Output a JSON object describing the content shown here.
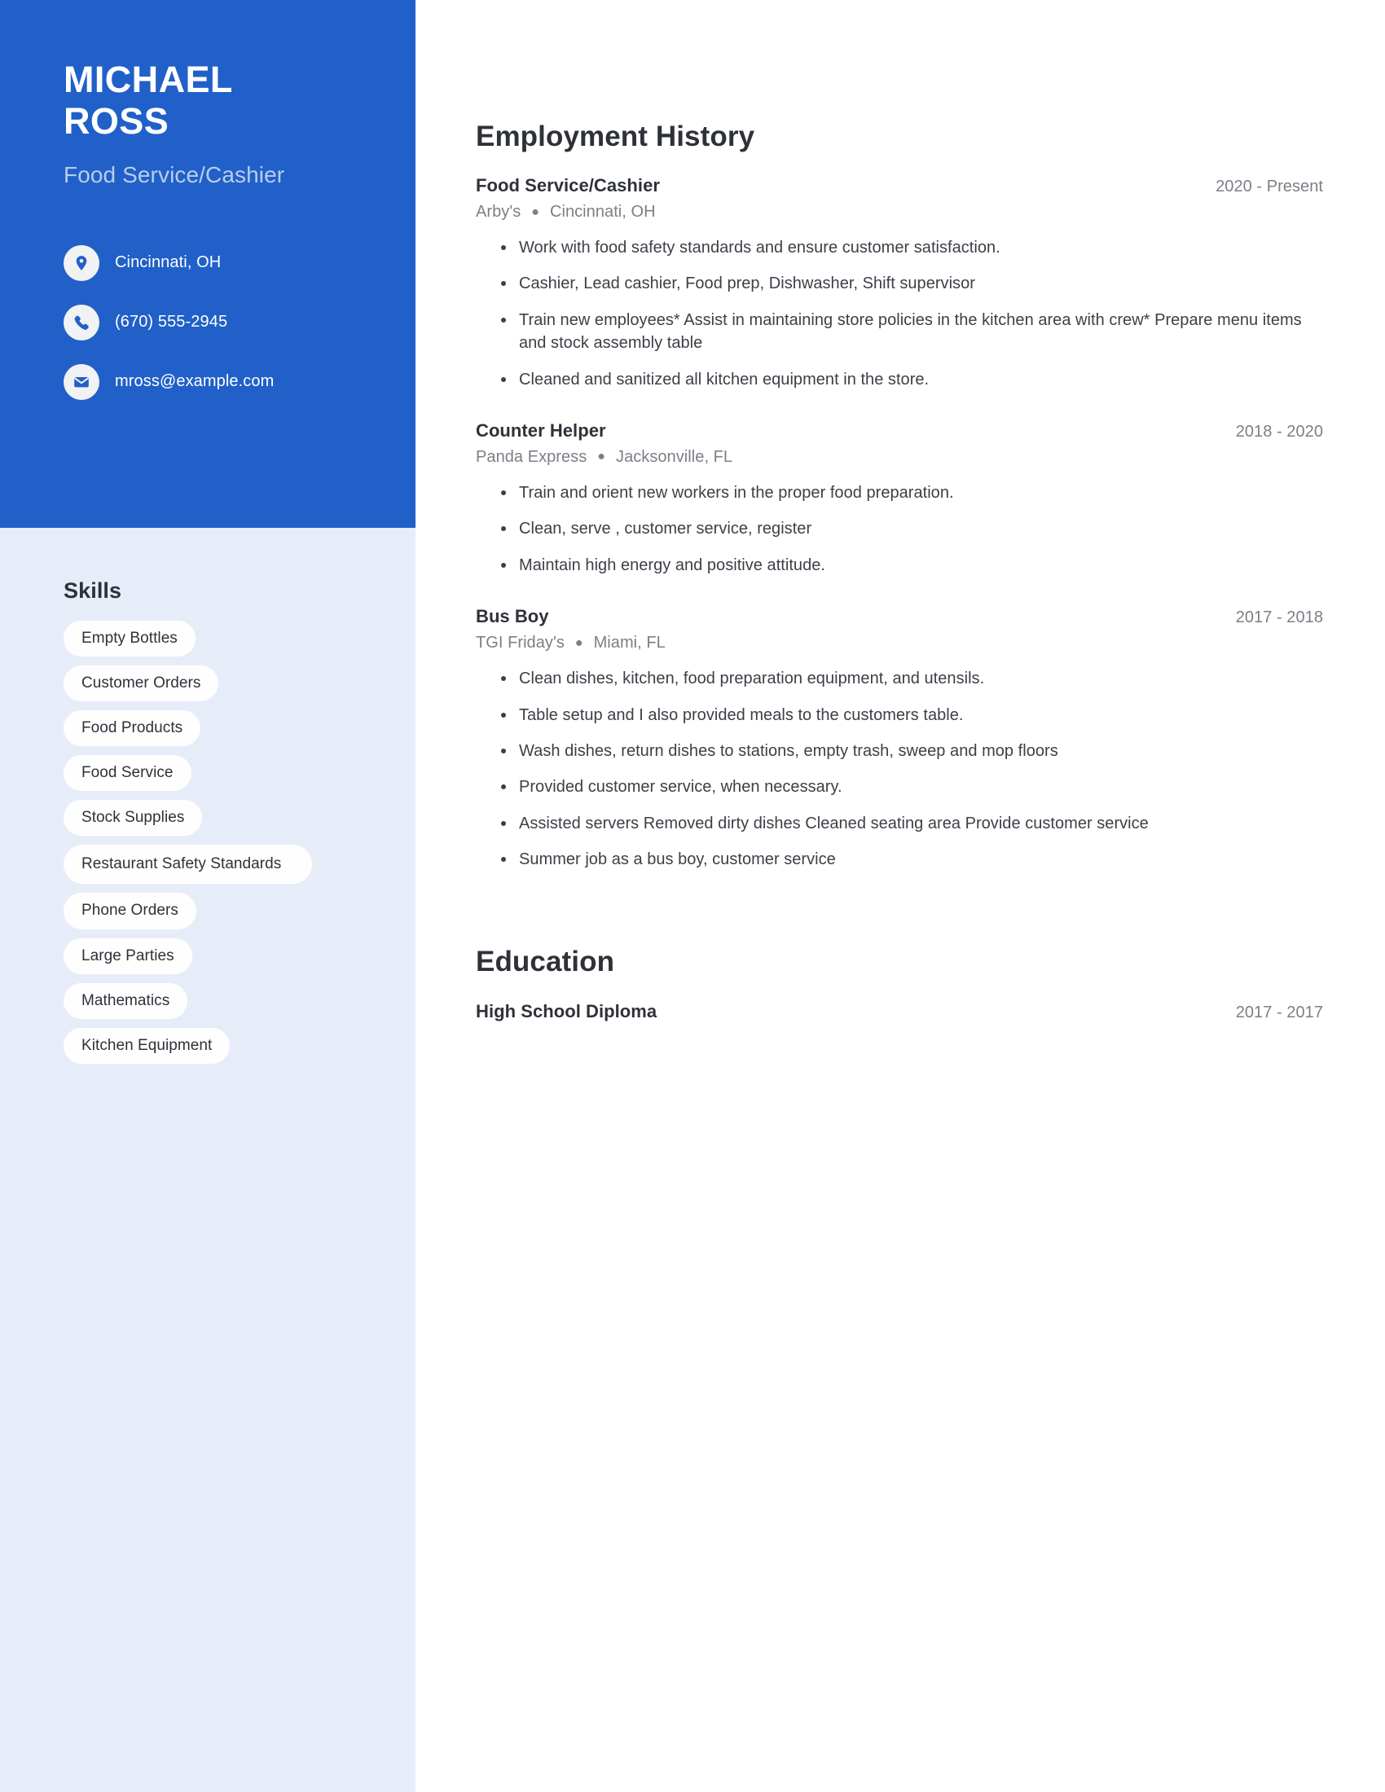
{
  "theme": {
    "accent": "#2160c8",
    "sidebar_body_bg": "#e7edf8",
    "pill_bg": "#fefeff",
    "heading_color": "#2e3238",
    "muted_color": "#7b7f86"
  },
  "sidebar": {
    "name_first": "MICHAEL",
    "name_last": "ROSS",
    "job_title": "Food Service/Cashier",
    "contacts": [
      {
        "icon": "location-pin-icon",
        "text": "Cincinnati, OH"
      },
      {
        "icon": "phone-icon",
        "text": "(670) 555-2945"
      },
      {
        "icon": "envelope-icon",
        "text": "mross@example.com"
      }
    ],
    "skills_title": "Skills",
    "skills": [
      "Empty Bottles",
      "Customer Orders",
      "Food Products",
      "Food Service",
      "Stock Supplies",
      "Restaurant Safety Standards",
      "Phone Orders",
      "Large Parties",
      "Mathematics",
      "Kitchen Equipment"
    ]
  },
  "main": {
    "employment_title": "Employment History",
    "employment": [
      {
        "role": "Food Service/Cashier",
        "dates": "2020 - Present",
        "company": "Arby's",
        "location": "Cincinnati, OH",
        "bullets": [
          "Work with food safety standards and ensure customer satisfaction.",
          "Cashier, Lead cashier, Food prep, Dishwasher, Shift supervisor",
          "Train new employees* Assist in maintaining store policies in the kitchen area with crew* Prepare menu items and stock assembly table",
          "Cleaned and sanitized all kitchen equipment in the store."
        ]
      },
      {
        "role": "Counter Helper",
        "dates": "2018 - 2020",
        "company": "Panda Express",
        "location": "Jacksonville, FL",
        "bullets": [
          "Train and orient new workers in the proper food preparation.",
          "Clean, serve , customer service, register",
          "Maintain high energy and positive attitude."
        ]
      },
      {
        "role": "Bus Boy",
        "dates": "2017 - 2018",
        "company": "TGI Friday's",
        "location": "Miami, FL",
        "bullets": [
          "Clean dishes, kitchen, food preparation equipment, and utensils.",
          "Table setup and I also provided meals to the customers table.",
          "Wash dishes, return dishes to stations, empty trash, sweep and mop floors",
          "Provided customer service, when necessary.",
          "Assisted servers Removed dirty dishes Cleaned seating area Provide customer service",
          "Summer job as a bus boy, customer service"
        ]
      }
    ],
    "education_title": "Education",
    "education": [
      {
        "degree": "High School Diploma",
        "dates": "2017 - 2017"
      }
    ]
  }
}
